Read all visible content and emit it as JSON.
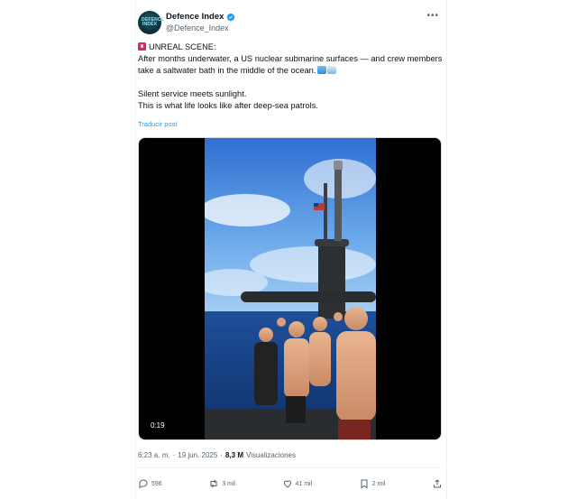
{
  "author": {
    "name": "Defence Index",
    "handle": "@Defence_Index",
    "avatar_text": "DEFENCE INDEX"
  },
  "tweet": {
    "headline": "UNREAL SCENE:",
    "line1": "After months underwater, a US nuclear submarine surfaces — and crew members take a saltwater bath in the middle of the ocean.",
    "line2": "Silent service meets sunlight.",
    "line3": "This is what life looks like after deep-sea patrols.",
    "translate_label": "Traducir post"
  },
  "media": {
    "duration": "0:19"
  },
  "meta": {
    "time": "6:23 a. m.",
    "separator": "·",
    "date": "19 jun. 2025",
    "views_count": "8,3 M",
    "views_label": "Visualizaciones"
  },
  "actions": {
    "replies": "596",
    "reposts": "3 mil",
    "likes": "41 mil",
    "bookmarks": "2 mil"
  },
  "colors": {
    "accent": "#1d9bf0",
    "text": "#0f1419",
    "muted": "#536471"
  }
}
